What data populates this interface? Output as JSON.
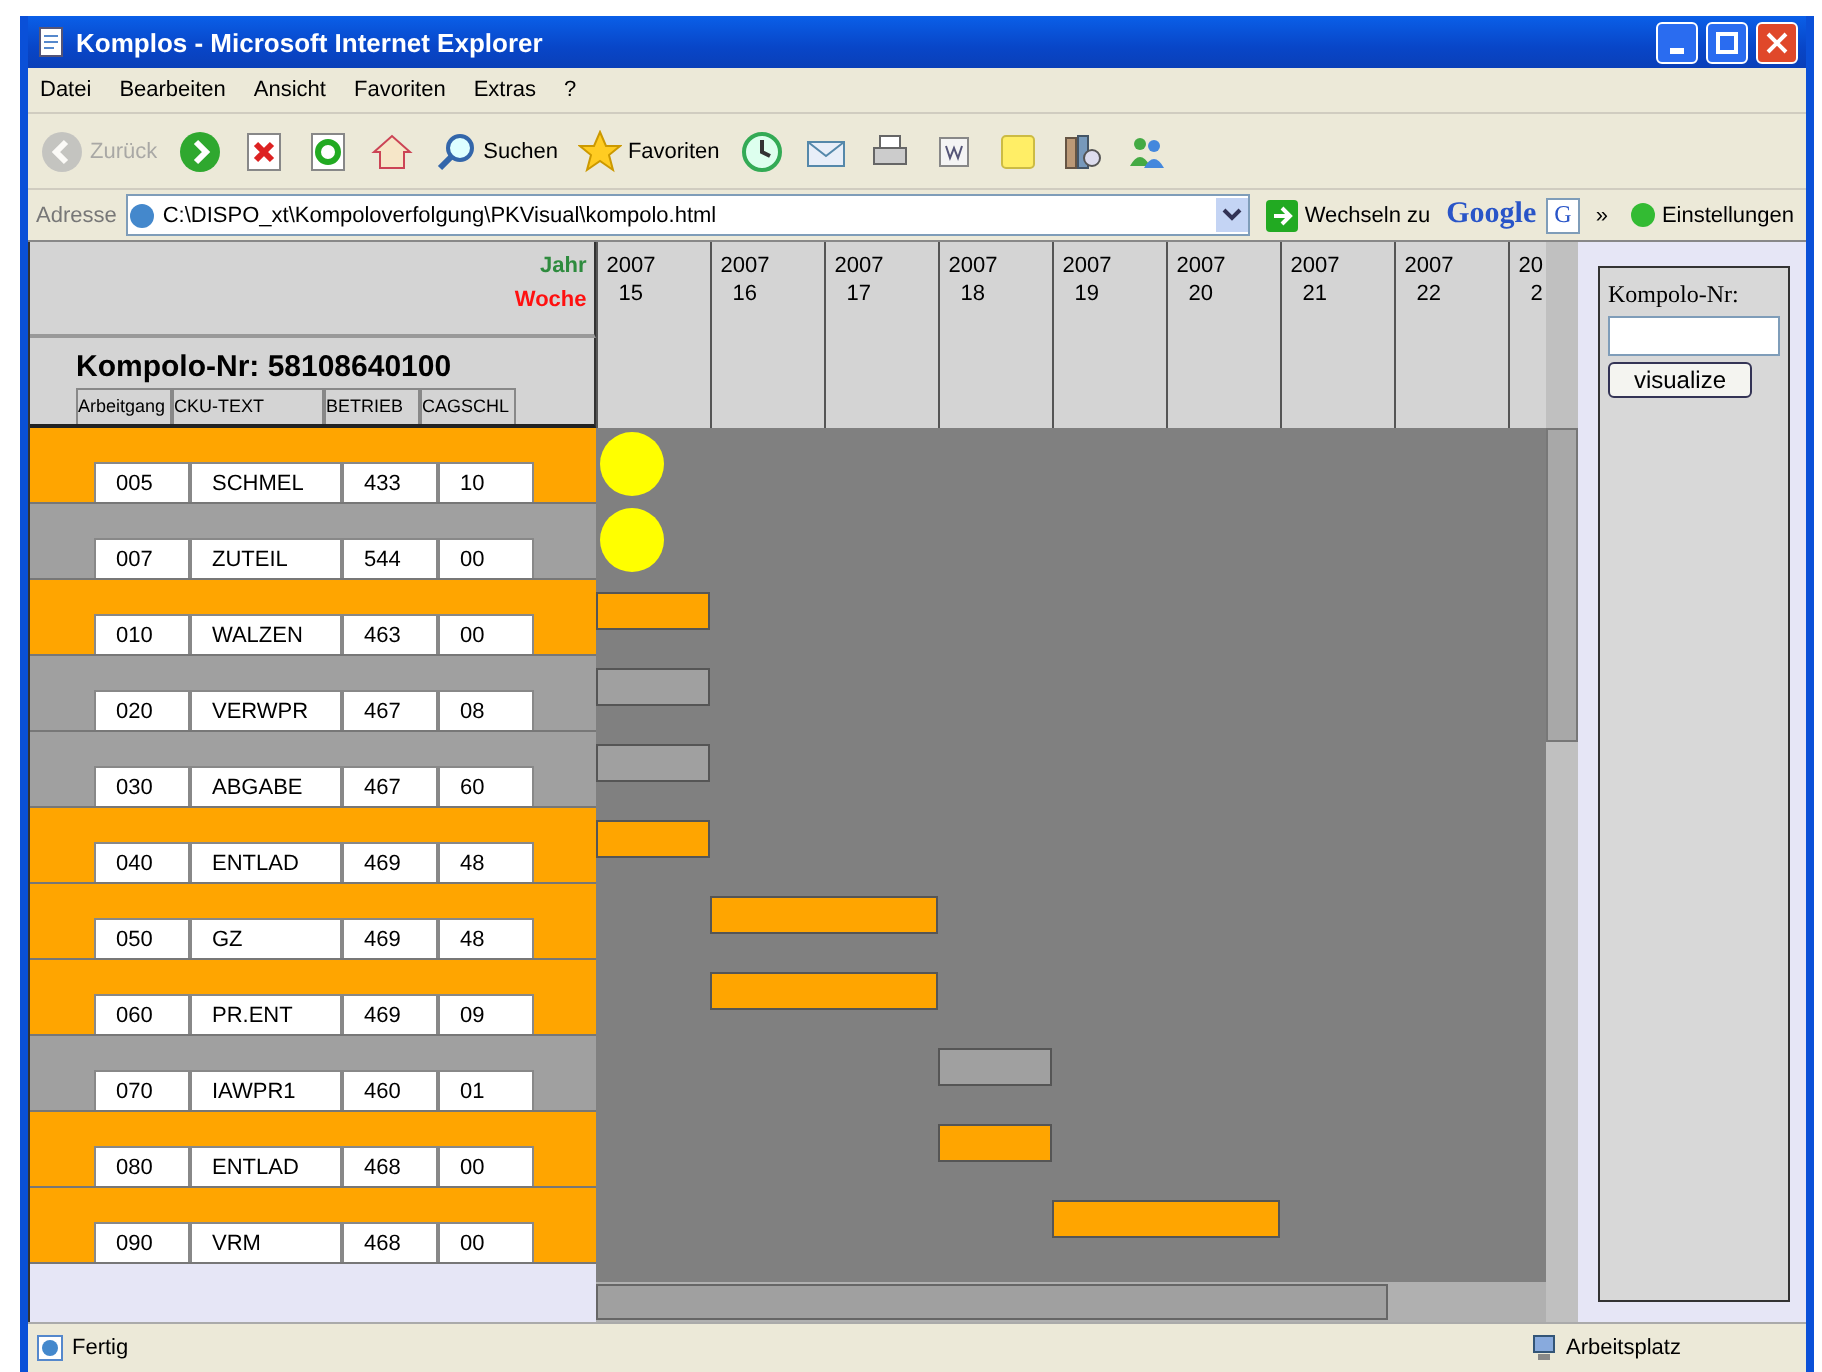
{
  "window": {
    "title": "Komplos - Microsoft Internet Explorer"
  },
  "menu": [
    "Datei",
    "Bearbeiten",
    "Ansicht",
    "Favoriten",
    "Extras",
    "?"
  ],
  "toolbar": [
    {
      "kind": "back",
      "label": "Zurück",
      "disabled": true
    },
    {
      "kind": "forward"
    },
    {
      "kind": "stop"
    },
    {
      "kind": "refresh"
    },
    {
      "kind": "home"
    },
    {
      "kind": "search",
      "label": "Suchen"
    },
    {
      "kind": "favorites",
      "label": "Favoriten"
    },
    {
      "kind": "history"
    },
    {
      "kind": "mail"
    },
    {
      "kind": "print"
    },
    {
      "kind": "edit"
    },
    {
      "kind": "notes"
    },
    {
      "kind": "research"
    },
    {
      "kind": "messenger"
    }
  ],
  "address": {
    "label": "Adresse",
    "url": "C:\\DISPO_xt\\Kompoloverfolgung\\PKVisual\\kompolo.html",
    "go": "Wechseln zu",
    "brand": "Google",
    "search_button": "G",
    "more": "»",
    "settings": "Einstellungen"
  },
  "page": {
    "year_label": "Jahr",
    "week_label": "Woche",
    "title": "Kompolo-Nr: 58108640100",
    "columns": [
      "Arbeitgang",
      "CKU-TEXT",
      "BETRIEB",
      "CAGSCHL"
    ],
    "weeks": [
      {
        "year": "2007",
        "week": "15"
      },
      {
        "year": "2007",
        "week": "16"
      },
      {
        "year": "2007",
        "week": "17"
      },
      {
        "year": "2007",
        "week": "18"
      },
      {
        "year": "2007",
        "week": "19"
      },
      {
        "year": "2007",
        "week": "20"
      },
      {
        "year": "2007",
        "week": "21"
      },
      {
        "year": "2007",
        "week": "22"
      },
      {
        "year": "20",
        "week": "2"
      }
    ],
    "rows": [
      {
        "cells": [
          "005",
          "SCHMEL",
          "433",
          "10"
        ],
        "color": "#ffa500",
        "bar": {
          "kind": "dot",
          "color": "#ffff00",
          "weeks": [
            true,
            false,
            false,
            false,
            false,
            false,
            false,
            false,
            false
          ]
        }
      },
      {
        "cells": [
          "007",
          "ZUTEIL",
          "544",
          "00"
        ],
        "color": "#a0a0a0",
        "bar": {
          "kind": "dot",
          "color": "#ffff00",
          "weeks": [
            true,
            false,
            false,
            false,
            false,
            false,
            false,
            false,
            false
          ]
        }
      },
      {
        "cells": [
          "010",
          "WALZEN",
          "463",
          "00"
        ],
        "color": "#ffa500",
        "bar": {
          "kind": "block",
          "color": "#ffa500",
          "weeks": [
            true,
            false,
            false,
            false,
            false,
            false,
            false,
            false,
            false
          ]
        }
      },
      {
        "cells": [
          "020",
          "VERWPR",
          "467",
          "08"
        ],
        "color": "#a0a0a0",
        "bar": {
          "kind": "block",
          "color": "#a0a0a0",
          "weeks": [
            true,
            false,
            false,
            false,
            false,
            false,
            false,
            false,
            false
          ]
        }
      },
      {
        "cells": [
          "030",
          "ABGABE",
          "467",
          "60"
        ],
        "color": "#a0a0a0",
        "bar": {
          "kind": "block",
          "color": "#a0a0a0",
          "weeks": [
            true,
            false,
            false,
            false,
            false,
            false,
            false,
            false,
            false
          ]
        }
      },
      {
        "cells": [
          "040",
          "ENTLAD",
          "469",
          "48"
        ],
        "color": "#ffa500",
        "bar": {
          "kind": "block",
          "color": "#ffa500",
          "weeks": [
            true,
            false,
            false,
            false,
            false,
            false,
            false,
            false,
            false
          ]
        }
      },
      {
        "cells": [
          "050",
          "GZ",
          "469",
          "48"
        ],
        "color": "#ffa500",
        "bar": {
          "kind": "block",
          "color": "#ffa500",
          "weeks": [
            false,
            true,
            true,
            false,
            false,
            false,
            false,
            false,
            false
          ]
        }
      },
      {
        "cells": [
          "060",
          "PR.ENT",
          "469",
          "09"
        ],
        "color": "#ffa500",
        "bar": {
          "kind": "block",
          "color": "#ffa500",
          "weeks": [
            false,
            true,
            true,
            false,
            false,
            false,
            false,
            false,
            false
          ]
        }
      },
      {
        "cells": [
          "070",
          "IAWPR1",
          "460",
          "01"
        ],
        "color": "#a0a0a0",
        "bar": {
          "kind": "block",
          "color": "#a0a0a0",
          "weeks": [
            false,
            false,
            false,
            true,
            false,
            false,
            false,
            false,
            false
          ]
        }
      },
      {
        "cells": [
          "080",
          "ENTLAD",
          "468",
          "00"
        ],
        "color": "#ffa500",
        "bar": {
          "kind": "block",
          "color": "#ffa500",
          "weeks": [
            false,
            false,
            false,
            true,
            false,
            false,
            false,
            false,
            false
          ]
        }
      },
      {
        "cells": [
          "090",
          "VRM",
          "468",
          "00"
        ],
        "color": "#ffa500",
        "bar": {
          "kind": "block",
          "color": "#ffa500",
          "weeks": [
            false,
            false,
            false,
            false,
            true,
            true,
            false,
            false,
            false
          ]
        }
      }
    ]
  },
  "side": {
    "label": "Kompolo-Nr:",
    "button": "visualize"
  },
  "status": {
    "text": "Fertig",
    "zone": "Arbeitsplatz"
  }
}
